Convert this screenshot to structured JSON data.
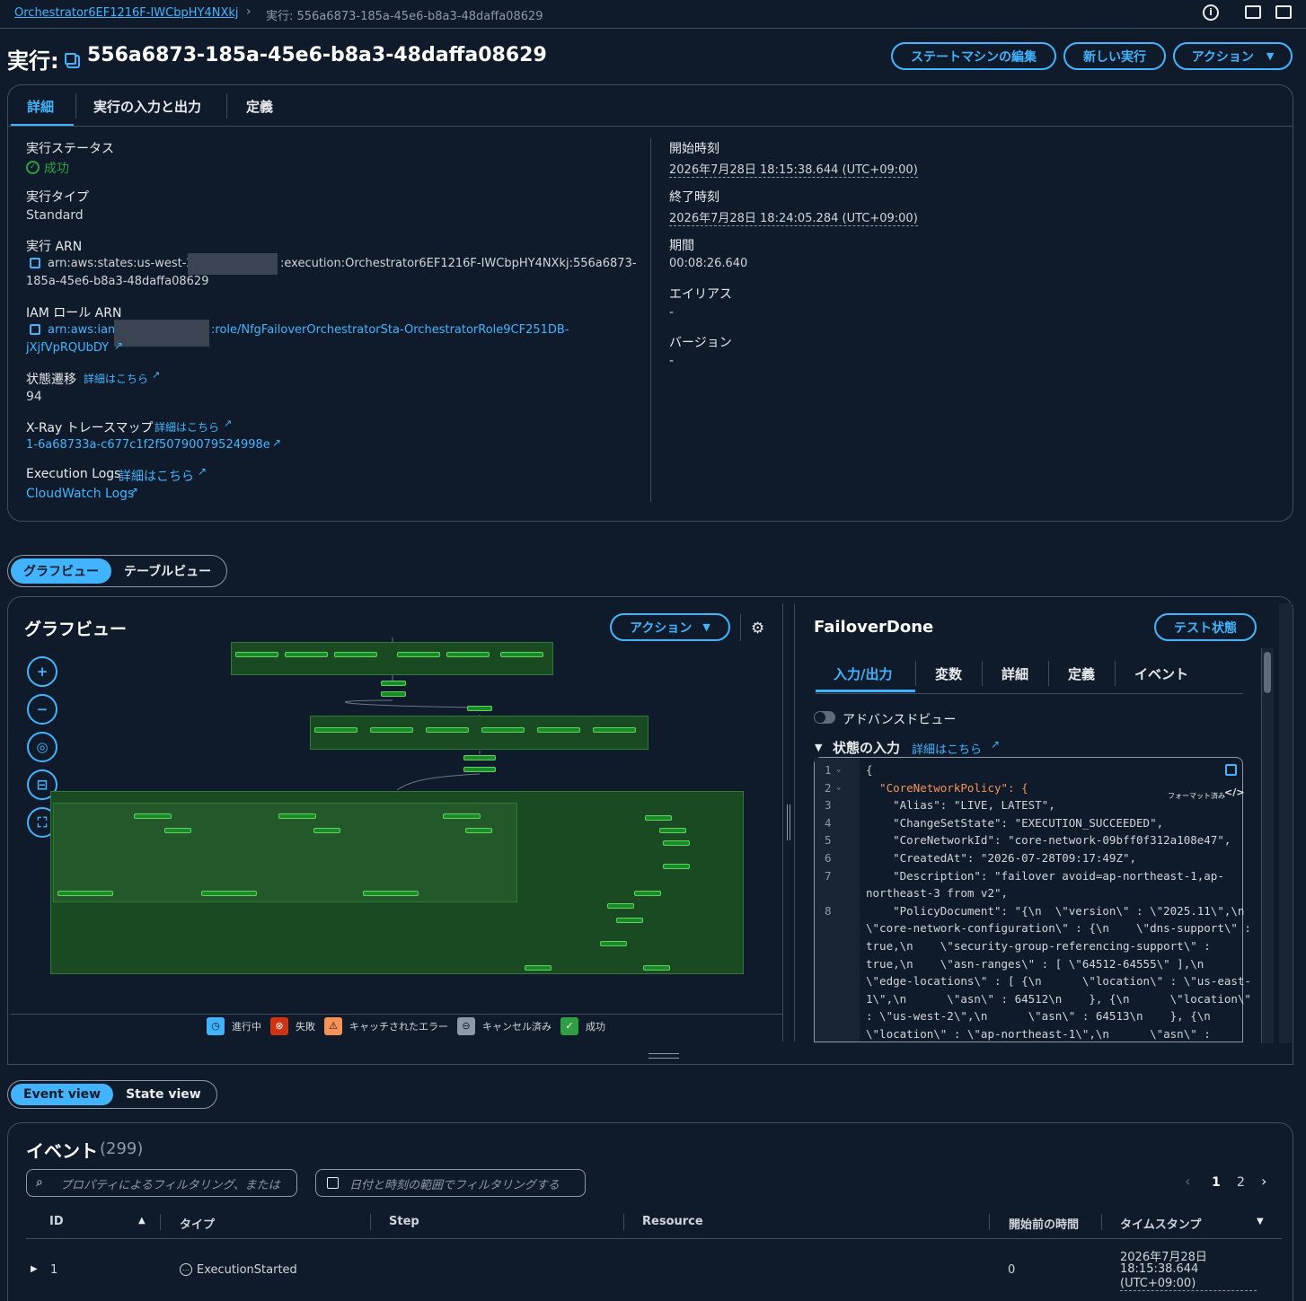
{
  "breadcrumb": {
    "parent": "Orchestrator6EF1216F-IWCbpHY4NXkj",
    "current": "実行: 556a6873-185a-45e6-b8a3-48daffa08629"
  },
  "header": {
    "title_prefix": "実行:",
    "execution_id": "556a6873-185a-45e6-b8a3-48daffa08629",
    "buttons": {
      "edit": "ステートマシンの編集",
      "new_execution": "新しい実行",
      "actions": "アクション"
    }
  },
  "tabs": [
    "詳細",
    "実行の入力と出力",
    "定義"
  ],
  "details": {
    "status_label": "実行ステータス",
    "status_value": "成功",
    "type_label": "実行タイプ",
    "type_value": "Standard",
    "arn_label": "実行 ARN",
    "arn_part1": "arn:aws:states:us-west-2",
    "arn_part2": ":execution:Orchestrator6EF1216F-IWCbpHY4NXkj:556a6873-",
    "arn_part3": "185a-45e6-b8a3-48daffa08629",
    "iam_label": "IAM ロール ARN",
    "iam_part1": "arn:aws:iam",
    "iam_part2": ":role/NfgFailoverOrchestratorSta-OrchestratorRole9CF251DB-",
    "iam_part3": "jXjfVpRQUbDY",
    "transitions_label": "状態遷移",
    "transitions_link": "詳細はこちら",
    "transitions_value": "94",
    "xray_label": "X-Ray トレースマップ",
    "xray_link": "詳細はこちら",
    "xray_value": "1-6a68733a-c677c1f2f50790079524998e",
    "logs_label": "Execution Logs",
    "logs_link": "詳細はこちら",
    "logs_value": "CloudWatch Logs",
    "start_label": "開始時刻",
    "start_value": "2026年7月28日 18:15:38.644 (UTC+09:00)",
    "end_label": "終了時刻",
    "end_value": "2026年7月28日 18:24:05.284 (UTC+09:00)",
    "duration_label": "期間",
    "duration_value": "00:08:26.640",
    "alias_label": "エイリアス",
    "alias_value": "-",
    "version_label": "バージョン",
    "version_value": "-"
  },
  "view_toggle": {
    "graph": "グラフビュー",
    "table": "テーブルビュー"
  },
  "graph": {
    "title": "グラフビュー",
    "actions": "アクション",
    "legend": [
      "進行中",
      "失敗",
      "キャッチされたエラー",
      "キャンセル済み",
      "成功"
    ],
    "colors": {
      "success": "#2ea043",
      "failed": "#d13212",
      "caught": "#f89256",
      "in_progress": "#42b4ff"
    }
  },
  "state_panel": {
    "title": "FailoverDone",
    "test_button": "テスト状態",
    "tabs": [
      "入力/出力",
      "変数",
      "詳細",
      "定義",
      "イベント"
    ],
    "advanced_view": "アドバンスドビュー",
    "input_label": "状態の入力",
    "input_link": "詳細はこちら",
    "format_label": "フォーマット済み",
    "line_numbers": [
      "1",
      "2",
      "3",
      "4",
      "5",
      "6",
      "7",
      "8"
    ],
    "code": [
      "{",
      "  \"CoreNetworkPolicy\": {",
      "    \"Alias\": \"LIVE, LATEST\",",
      "    \"ChangeSetState\": \"EXECUTION_SUCCEEDED\",",
      "    \"CoreNetworkId\": \"core-network-09bff0f312a108e47\",",
      "    \"CreatedAt\": \"2026-07-28T09:17:49Z\",",
      "    \"Description\": \"failover avoid=ap-northeast-1,ap-",
      "northeast-3 from v2\",",
      "    \"PolicyDocument\": \"{\\n  \\\"version\\\" : \\\"2025.11\\\",\\n",
      "\\\"core-network-configuration\\\" : {\\n    \\\"dns-support\\\" :",
      "true,\\n    \\\"security-group-referencing-support\\\" :",
      "true,\\n    \\\"asn-ranges\\\" : [ \\\"64512-64555\\\" ],\\n",
      "\\\"edge-locations\\\" : [ {\\n      \\\"location\\\" : \\\"us-east-",
      "1\\\",\\n      \\\"asn\\\" : 64512\\n    }, {\\n      \\\"location\\\"",
      ": \\\"us-west-2\\\",\\n      \\\"asn\\\" : 64513\\n    }, {\\n",
      "\\\"location\\\" : \\\"ap-northeast-1\\\",\\n      \\\"asn\\\" :"
    ]
  },
  "event_toggle": {
    "event": "Event view",
    "state": "State view"
  },
  "events": {
    "title": "イベント",
    "count": "(299)",
    "search_placeholder": "プロパティによるフィルタリング、または",
    "date_filter": "日付と時刻の範囲でフィルタリングする",
    "pages": [
      "1",
      "2"
    ],
    "columns": [
      "ID",
      "タイプ",
      "Step",
      "Resource",
      "開始前の時間",
      "タイムスタンプ"
    ],
    "rows": [
      {
        "id": "1",
        "type": "ExecutionStarted",
        "step": "",
        "resource": "",
        "elapsed": "0",
        "ts1": "2026年7月28日",
        "ts2": "18:15:38.644",
        "ts3": "(UTC+09:00)"
      }
    ]
  }
}
